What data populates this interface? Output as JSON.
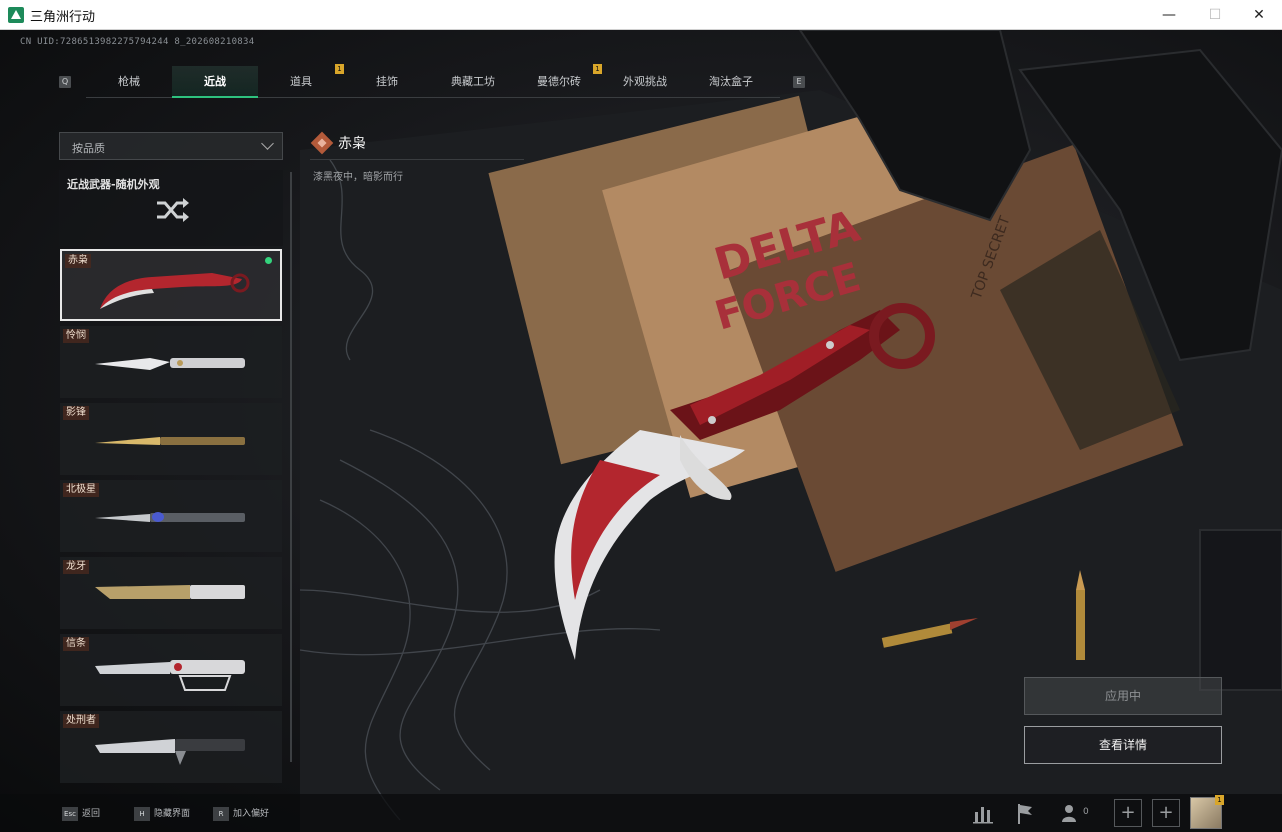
{
  "window": {
    "title": "三角洲行动",
    "minimize": "—",
    "maximize": "☐",
    "close": "✕"
  },
  "uid_text": "CN UID:7286513982275794244 8_202608210834",
  "tabs": [
    {
      "label": "枪械",
      "badge": ""
    },
    {
      "label": "近战",
      "badge": "",
      "active": true
    },
    {
      "label": "道具",
      "badge": "1"
    },
    {
      "label": "挂饰",
      "badge": ""
    },
    {
      "label": "典藏工坊",
      "badge": ""
    },
    {
      "label": "曼德尔砖",
      "badge": "1"
    },
    {
      "label": "外观挑战",
      "badge": ""
    },
    {
      "label": "淘汰盒子",
      "badge": ""
    }
  ],
  "tab_keys": {
    "left": "Q",
    "right": "E"
  },
  "sort": {
    "label": "按品质"
  },
  "random": {
    "title": "近战武器-随机外观"
  },
  "items": [
    {
      "tag": "赤枭",
      "selected": true,
      "equipped": true
    },
    {
      "tag": "怜悯"
    },
    {
      "tag": "影锋"
    },
    {
      "tag": "北极星"
    },
    {
      "tag": "龙牙"
    },
    {
      "tag": "信条"
    },
    {
      "tag": "处刑者"
    }
  ],
  "skin": {
    "name": "赤枭",
    "desc": "漆黑夜中，暗影而行"
  },
  "buttons": {
    "in_use": "应用中",
    "details": "查看详情"
  },
  "bottom": {
    "back_key": "Esc",
    "back_label": "返回",
    "hide_key": "H",
    "hide_label": "隐藏界面",
    "fav_key": "R",
    "fav_label": "加入偏好",
    "friends_count": "0",
    "plus": "+",
    "avatar_badge": "1"
  },
  "colors": {
    "accent": "#2ec27e",
    "badge": "#d9a62a",
    "knife_red": "#b3262e"
  }
}
